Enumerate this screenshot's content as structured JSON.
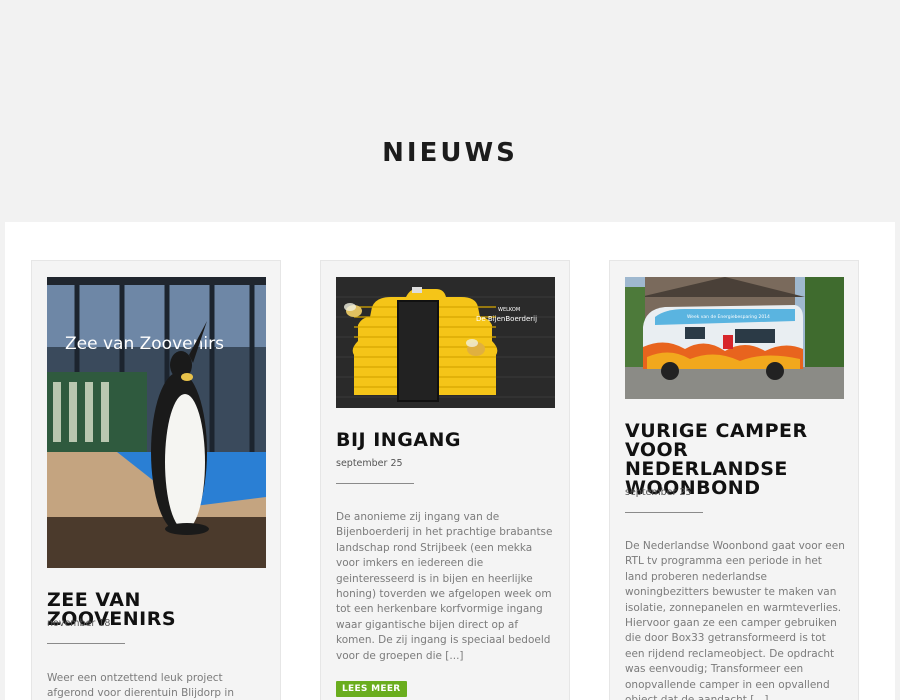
{
  "page": {
    "title": "NIEUWS"
  },
  "posts": [
    {
      "title": "ZEE VAN ZOOVENIRS",
      "date": "november 18",
      "excerpt": "Weer een ontzettend leuk project afgerond voor dierentuin Blijdorp in Rotterdam, de",
      "image_text": "Zee van Zoovenirs"
    },
    {
      "title": "BIJ INGANG",
      "date": "september 25",
      "excerpt": "De anonieme zij ingang van de Bijenboerderij in het prachtige brabantse landschap rond Strijbeek (een mekka voor imkers en iedereen die geinteresseerd is in bijen en heerlijke honing) toverden we afgelopen week om tot een herkenbare korfvormige ingang waar gigantische bijen direct op af komen. De zij ingang is speciaal bedoeld voor de groepen die [...]",
      "read_more": "LEES MEER",
      "image_sign_top": "WELKOM",
      "image_sign_main": "De BijenBoerderij"
    },
    {
      "title": "VURIGE CAMPER VOOR NEDERLANDSE WOONBOND",
      "date": "september 25",
      "excerpt": "De Nederlandse Woonbond gaat voor een RTL tv programma een periode in het land proberen nederlandse woningbezitters bewuster te maken van isolatie, zonnepanelen en warmteverlies. Hiervoor gaan ze een camper gebruiken die door Box33 getransformeerd is tot een rijdend reclameobject.   De opdracht was eenvoudig; Transformeer een onopvallende camper in een opvallend object dat de aandacht [...]",
      "image_banner": "Week van de Energiebesparing 2014"
    }
  ],
  "colors": {
    "button_green": "#6aad1e",
    "background": "#f2f2f2"
  }
}
